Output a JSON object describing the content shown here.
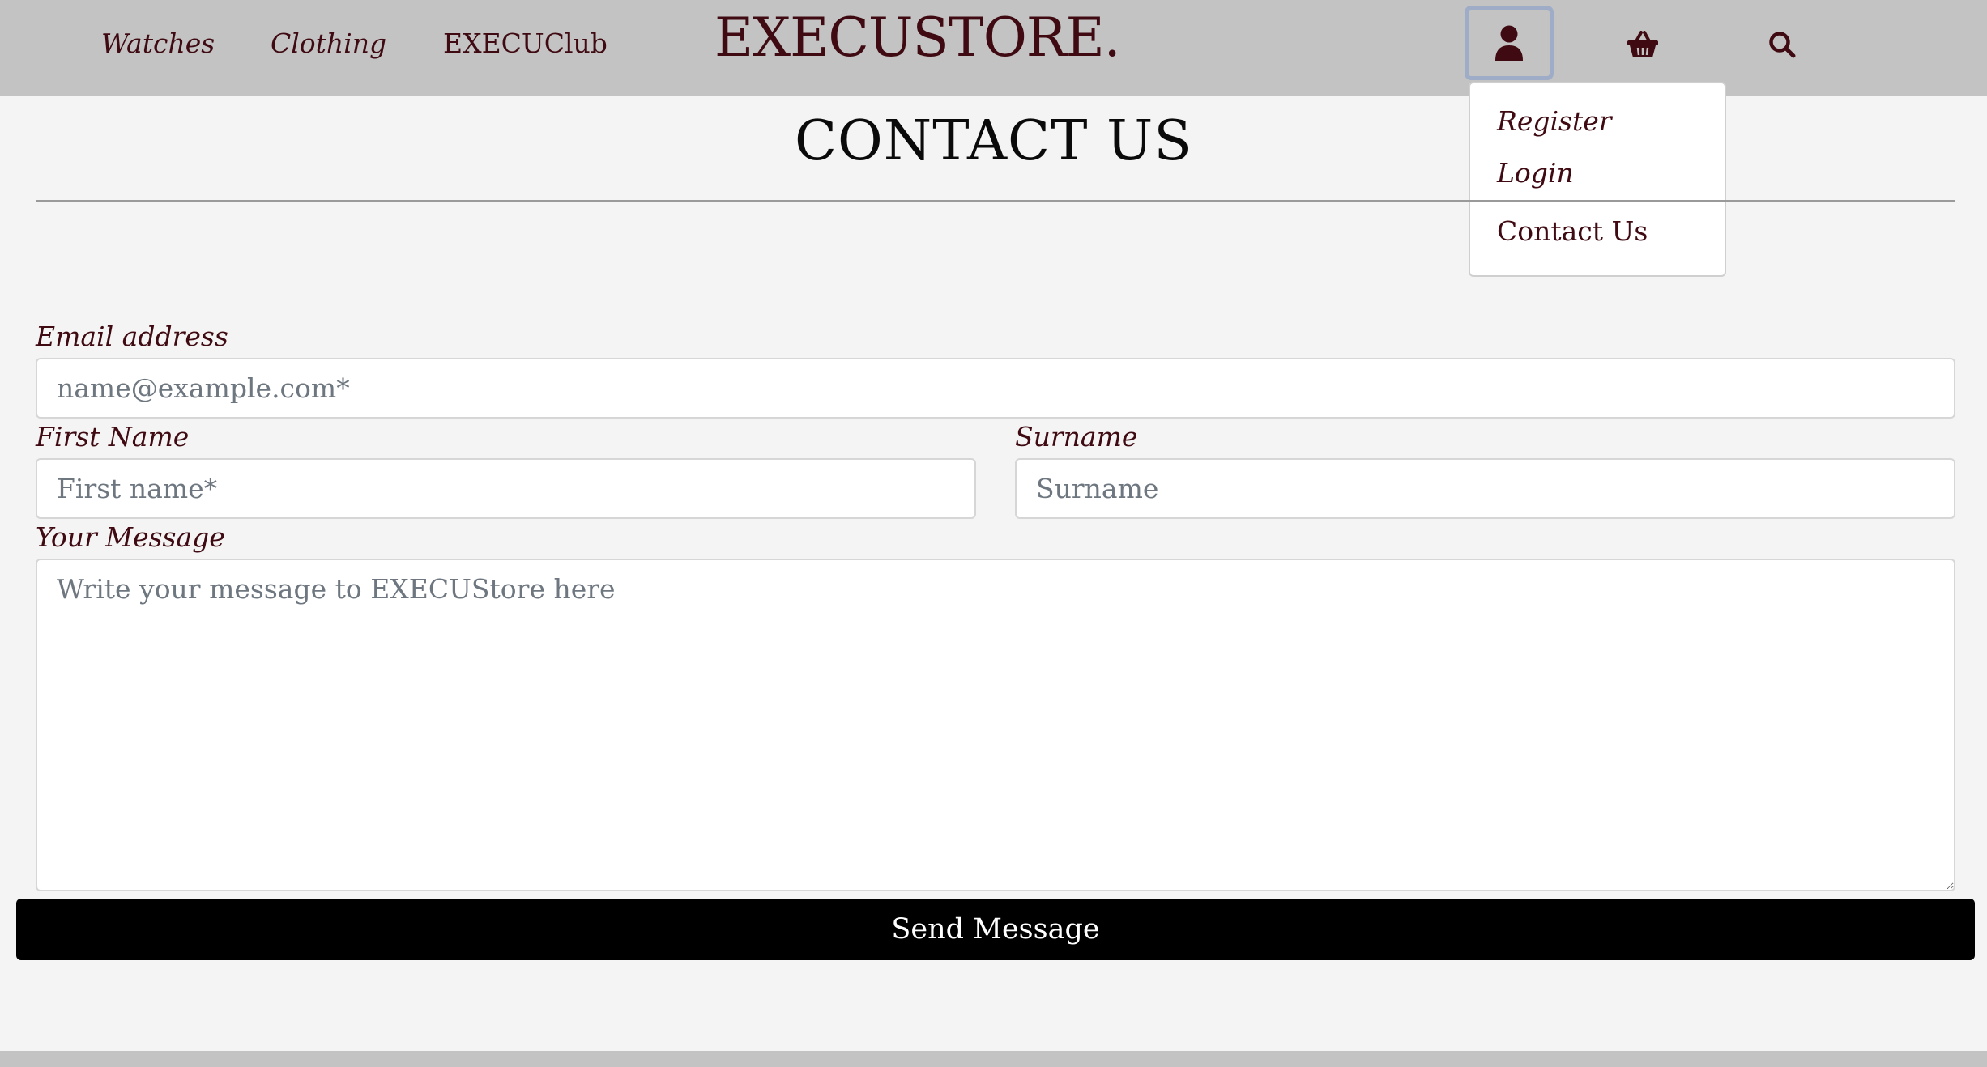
{
  "header": {
    "nav": [
      {
        "label": "Watches"
      },
      {
        "label": "Clothing"
      },
      {
        "label": "EXECUClub"
      }
    ],
    "brand": "EXECUSTORE.",
    "icons": {
      "account": "user-icon",
      "basket": "basket-icon",
      "search": "search-icon"
    }
  },
  "account_menu": {
    "items": [
      {
        "label": "Register"
      },
      {
        "label": "Login"
      },
      {
        "label": "Contact Us"
      }
    ]
  },
  "page": {
    "title": "CONTACT US"
  },
  "form": {
    "email": {
      "label": "Email address",
      "placeholder": "name@example.com*",
      "value": ""
    },
    "first_name": {
      "label": "First Name",
      "placeholder": "First name*",
      "value": ""
    },
    "surname": {
      "label": "Surname",
      "placeholder": "Surname",
      "value": ""
    },
    "message": {
      "label": "Your Message",
      "placeholder": "Write your message to EXECUStore here",
      "value": ""
    },
    "submit_label": "Send Message"
  },
  "colors": {
    "accent": "#3f0a12",
    "header_bg": "#c3c3c3",
    "page_bg": "#f4f4f4",
    "button_bg": "#000000"
  }
}
